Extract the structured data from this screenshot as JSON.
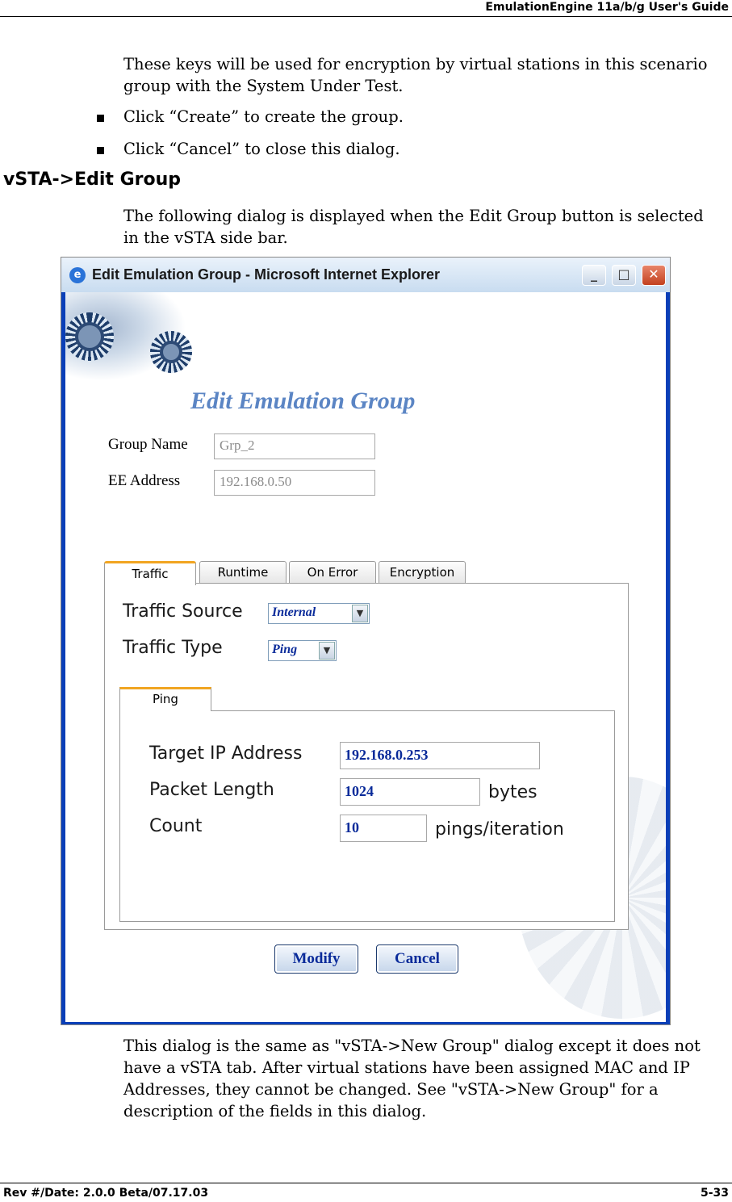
{
  "header": {
    "title": "EmulationEngine 11a/b/g User's Guide"
  },
  "intro": {
    "paragraph": "These keys will be used for encryption by virtual stations in this scenario group with the System Under Test.",
    "bullets": [
      "Click “Create” to create the group.",
      "Click “Cancel” to close this dialog."
    ]
  },
  "section": {
    "heading": "vSTA->Edit Group",
    "paragraph": "The following dialog is displayed when the Edit Group button is selected in the vSTA side bar."
  },
  "screenshot": {
    "window_title": "Edit Emulation Group - Microsoft Internet Explorer",
    "window_buttons": {
      "minimize": "_",
      "maximize": "□",
      "close": "✕"
    },
    "page_title": "Edit Emulation Group",
    "fields": [
      {
        "label": "Group Name",
        "value": "Grp_2"
      },
      {
        "label": "EE Address",
        "value": "192.168.0.50"
      }
    ],
    "tabs": [
      "Traffic",
      "Runtime",
      "On Error",
      "Encryption"
    ],
    "active_tab": "Traffic",
    "traffic": {
      "source_label": "Traffic Source",
      "source_value": "Internal",
      "type_label": "Traffic Type",
      "type_value": "Ping"
    },
    "subtab": "Ping",
    "ping": {
      "target_label": "Target IP Address",
      "target_value": "192.168.0.253",
      "length_label": "Packet Length",
      "length_value": "1024",
      "length_unit": "bytes",
      "count_label": "Count",
      "count_value": "10",
      "count_unit": "pings/iteration"
    },
    "buttons": {
      "modify": "Modify",
      "cancel": "Cancel"
    },
    "icons": [
      "ie-icon",
      "gear-icon",
      "chevron-down-icon"
    ]
  },
  "outro": {
    "paragraph": "This dialog is the same as \"vSTA->New Group\" dialog except it does not have a vSTA tab. After virtual stations have been assigned MAC and IP Addresses, they cannot be changed. See \"vSTA->New Group\" for a description of the fields in this dialog."
  },
  "footer": {
    "left": "Rev #/Date: 2.0.0 Beta/07.17.03",
    "right": "5-33"
  }
}
